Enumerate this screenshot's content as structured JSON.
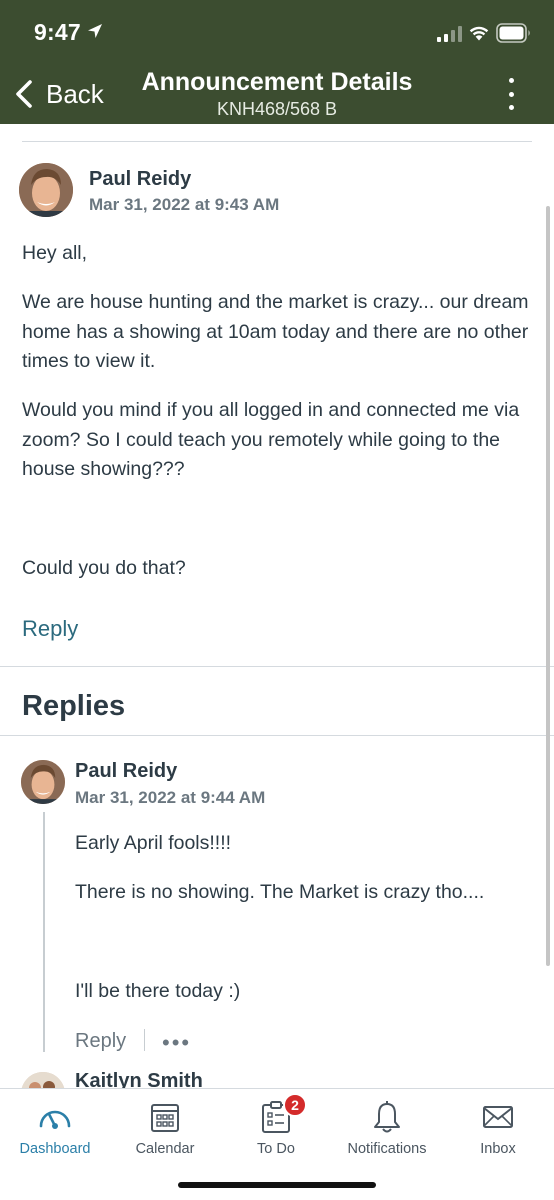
{
  "status_bar": {
    "time": "9:47"
  },
  "nav": {
    "back_label": "Back",
    "title": "Announcement Details",
    "subtitle": "KNH468/568 B"
  },
  "announcement": {
    "author": "Paul Reidy",
    "date": "Mar 31, 2022 at 9:43 AM",
    "paragraphs": [
      "Hey all,",
      "We are house hunting and the market is crazy... our dream home has a showing at 10am today and there are no other times to view it.",
      "Would you mind if you all logged in and connected me via zoom?  So I could teach you remotely while going to the house showing???",
      "Could you do that?"
    ],
    "reply_label": "Reply"
  },
  "replies": {
    "title": "Replies",
    "items": [
      {
        "author": "Paul Reidy",
        "date": "Mar 31, 2022 at 9:44 AM",
        "paragraphs": [
          "Early April fools!!!!",
          "There is no showing.  The Market is crazy tho....",
          "I'll be there today :)"
        ],
        "reply_label": "Reply",
        "more_label": "•••"
      },
      {
        "author": "Kaitlyn Smith"
      }
    ]
  },
  "tabbar": {
    "tabs": [
      {
        "label": "Dashboard",
        "icon": "dashboard-icon",
        "active": true
      },
      {
        "label": "Calendar",
        "icon": "calendar-icon"
      },
      {
        "label": "To Do",
        "icon": "todo-icon",
        "badge": "2"
      },
      {
        "label": "Notifications",
        "icon": "bell-icon"
      },
      {
        "label": "Inbox",
        "icon": "inbox-icon"
      }
    ]
  },
  "colors": {
    "header_bg": "#3c4d30",
    "link": "#2b6a7e",
    "active_tab": "#2b7fa8",
    "badge": "#d42b2b"
  }
}
